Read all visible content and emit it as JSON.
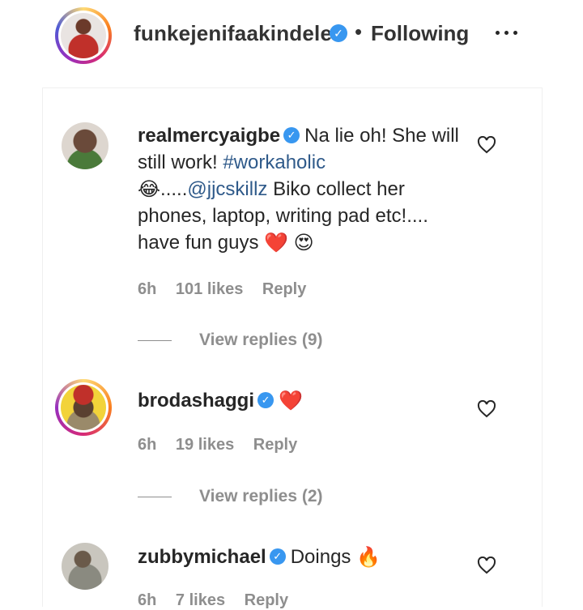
{
  "post_header": {
    "username": "funkejenifaakindele",
    "separator": "•",
    "follow_status": "Following",
    "more_icon": "more-horizontal-icon"
  },
  "comments": [
    {
      "username": "realmercyaigbe",
      "text_before_hashtag": "Na lie oh! She will still work! ",
      "hashtag": "#workaholic",
      "emoji_1": "😂",
      "text_mid": ".....",
      "mention": "@jjcskillz",
      "text_after_mention": " Biko collect her phones, laptop, writing pad etc!.... have fun guys ",
      "emoji_2": "❤️",
      "emoji_3": "😍",
      "time": "6h",
      "likes": "101 likes",
      "reply": "Reply",
      "view_replies": "View replies (9)"
    },
    {
      "username": "brodashaggi",
      "emoji_1": "❤️",
      "time": "6h",
      "likes": "19 likes",
      "reply": "Reply",
      "view_replies": "View replies (2)"
    },
    {
      "username": "zubbymichael",
      "text": "Doings ",
      "emoji_1": "🔥",
      "time": "6h",
      "likes": "7 likes",
      "reply": "Reply"
    }
  ],
  "colors": {
    "verified_blue": "#3897f0",
    "link_blue": "#2f5a8a",
    "meta_gray": "#8e8e8e"
  }
}
